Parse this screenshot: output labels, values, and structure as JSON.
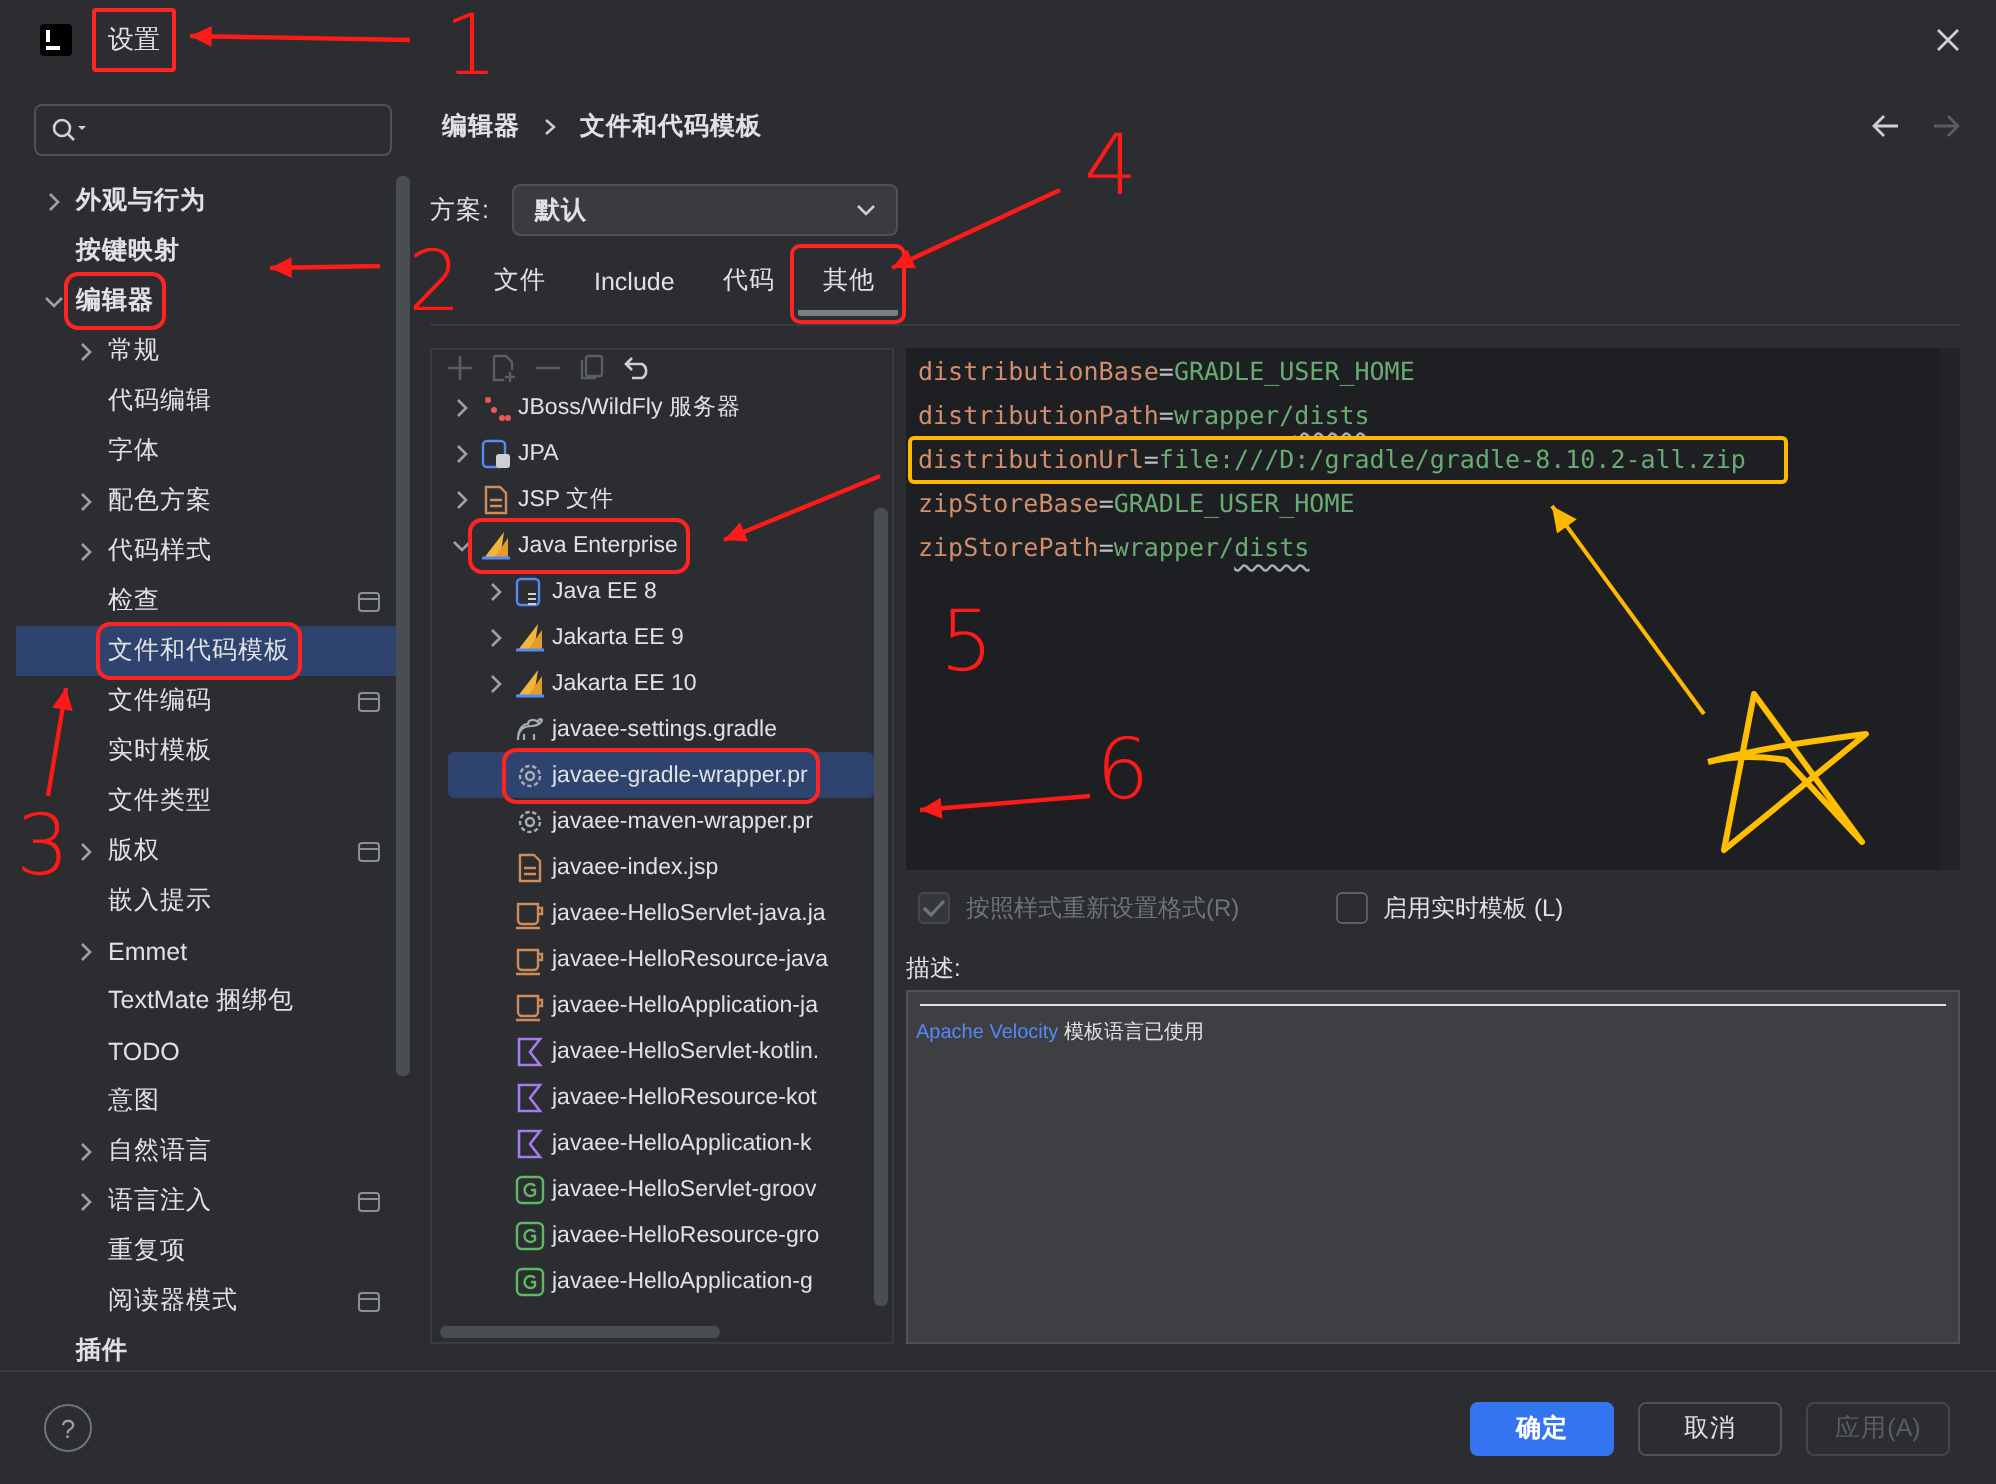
{
  "window": {
    "title": "设置",
    "annotated": true
  },
  "sidebar": {
    "items": [
      {
        "label": "外观与行为",
        "expanded": false,
        "selected": false
      },
      {
        "label": "按键映射",
        "selected": false
      },
      {
        "label": "编辑器",
        "expanded": true,
        "selected": false,
        "annotated": true,
        "children": [
          {
            "label": "常规",
            "expanded": false,
            "selected": false
          },
          {
            "label": "代码编辑",
            "selected": false
          },
          {
            "label": "字体",
            "selected": false
          },
          {
            "label": "配色方案",
            "expanded": false,
            "selected": false
          },
          {
            "label": "代码样式",
            "expanded": false,
            "selected": false
          },
          {
            "label": "检查",
            "project_icon": true,
            "selected": false
          },
          {
            "label": "文件和代码模板",
            "selected": true,
            "annotated": true
          },
          {
            "label": "文件编码",
            "project_icon": true,
            "selected": false
          },
          {
            "label": "实时模板",
            "selected": false
          },
          {
            "label": "文件类型",
            "selected": false
          },
          {
            "label": "版权",
            "expanded": false,
            "project_icon": true,
            "selected": false
          },
          {
            "label": "嵌入提示",
            "selected": false
          },
          {
            "label": "Emmet",
            "expanded": false,
            "selected": false
          },
          {
            "label": "TextMate 捆绑包",
            "selected": false
          },
          {
            "label": "TODO",
            "selected": false
          },
          {
            "label": "意图",
            "selected": false
          },
          {
            "label": "自然语言",
            "expanded": false,
            "selected": false
          },
          {
            "label": "语言注入",
            "expanded": false,
            "project_icon": true,
            "selected": false
          },
          {
            "label": "重复项",
            "selected": false
          },
          {
            "label": "阅读器模式",
            "project_icon": true,
            "selected": false
          }
        ]
      },
      {
        "label": "插件",
        "selected": false
      }
    ]
  },
  "breadcrumb": [
    "编辑器",
    "文件和代码模板"
  ],
  "scheme": {
    "label": "方案:",
    "value": "默认"
  },
  "tabs": [
    {
      "label": "文件",
      "selected": false
    },
    {
      "label": "Include",
      "selected": false
    },
    {
      "label": "代码",
      "selected": false
    },
    {
      "label": "其他",
      "selected": true,
      "annotated": true
    }
  ],
  "templates": [
    {
      "label": "JBoss/WildFly 服务器",
      "kind": "server",
      "expanded": false,
      "selected": false
    },
    {
      "label": "JPA",
      "kind": "jpa",
      "expanded": false,
      "selected": false
    },
    {
      "label": "JSP 文件",
      "kind": "jsp",
      "expanded": false,
      "selected": false
    },
    {
      "label": "Java Enterprise",
      "kind": "sail",
      "expanded": true,
      "selected": false,
      "annotated": true,
      "children": [
        {
          "label": "Java EE 8",
          "kind": "ee",
          "expanded": false,
          "selected": false
        },
        {
          "label": "Jakarta EE 9",
          "kind": "sail",
          "expanded": false,
          "selected": false
        },
        {
          "label": "Jakarta EE 10",
          "kind": "sail",
          "expanded": false,
          "selected": false
        },
        {
          "label": "javaee-settings.gradle",
          "kind": "gradle",
          "selected": false
        },
        {
          "label": "javaee-gradle-wrapper.pr",
          "kind": "gear",
          "selected": true,
          "annotated": true
        },
        {
          "label": "javaee-maven-wrapper.pr",
          "kind": "gear",
          "selected": false
        },
        {
          "label": "javaee-index.jsp",
          "kind": "jsp",
          "selected": false
        },
        {
          "label": "javaee-HelloServlet-java.ja",
          "kind": "java",
          "selected": false
        },
        {
          "label": "javaee-HelloResource-java",
          "kind": "java",
          "selected": false
        },
        {
          "label": "javaee-HelloApplication-ja",
          "kind": "java",
          "selected": false
        },
        {
          "label": "javaee-HelloServlet-kotlin.",
          "kind": "kotlin",
          "selected": false
        },
        {
          "label": "javaee-HelloResource-kot",
          "kind": "kotlin",
          "selected": false
        },
        {
          "label": "javaee-HelloApplication-k",
          "kind": "kotlin",
          "selected": false
        },
        {
          "label": "javaee-HelloServlet-groov",
          "kind": "groovy",
          "selected": false
        },
        {
          "label": "javaee-HelloResource-gro",
          "kind": "groovy",
          "selected": false
        },
        {
          "label": "javaee-HelloApplication-g",
          "kind": "groovy",
          "selected": false
        }
      ]
    }
  ],
  "editor": {
    "lines": [
      {
        "key": "distributionBase",
        "sep": "=",
        "value": "GRADLE_USER_HOME"
      },
      {
        "key": "distributionPath",
        "sep": "=",
        "value": "wrapper/",
        "flagged": "dists"
      },
      {
        "key": "distributionUrl",
        "sep": "=",
        "value": "file:///D:/gradle/gradle-8.10.2-all.zip",
        "annotated": true
      },
      {
        "key": "zipStoreBase",
        "sep": "=",
        "value": "GRADLE_USER_HOME"
      },
      {
        "key": "zipStorePath",
        "sep": "=",
        "value": "wrapper/",
        "flagged": "dists"
      }
    ]
  },
  "options": [
    {
      "label": "按照样式重新设置格式(R)",
      "checked": true,
      "disabled": true
    },
    {
      "label": "启用实时模板 (L)",
      "checked": false,
      "disabled": false
    }
  ],
  "description": {
    "label": "描述:",
    "link": "Apache Velocity",
    "text": "模板语言已使用"
  },
  "footer": {
    "help": "?",
    "buttons": [
      {
        "label": "确定",
        "kind": "primary"
      },
      {
        "label": "取消",
        "kind": "normal"
      },
      {
        "label": "应用(A)",
        "kind": "disabled"
      }
    ]
  },
  "annotations": [
    {
      "label": "1"
    },
    {
      "label": "2"
    },
    {
      "label": "3"
    },
    {
      "label": "4"
    },
    {
      "label": "5"
    },
    {
      "label": "6"
    }
  ]
}
